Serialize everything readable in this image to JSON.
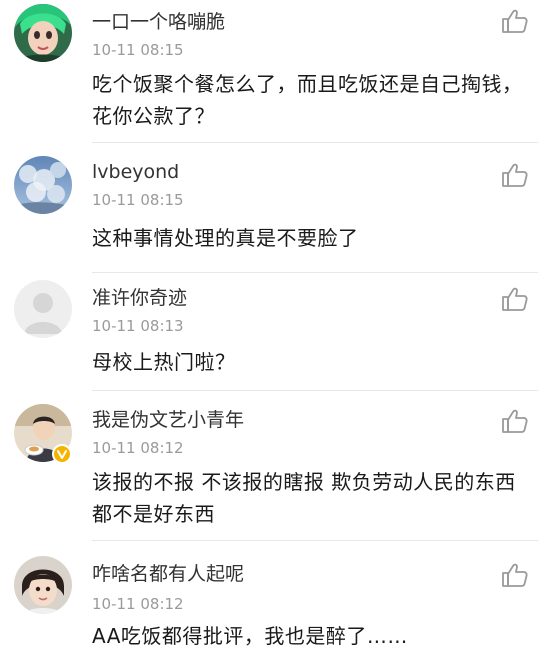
{
  "comments": [
    {
      "username": "一口一个咯嘣脆",
      "time": "10-11 08:15",
      "text": "吃个饭聚个餐怎么了，而且吃饭还是自己掏钱，花你公款了？",
      "avatar_icon": "green-hair-avatar-icon",
      "like_icon": "thumbs-up-icon"
    },
    {
      "username": "lvbeyond",
      "time": "10-11 08:15",
      "text": "这种事情处理的真是不要脸了",
      "avatar_icon": "sky-photo-avatar-icon",
      "like_icon": "thumbs-up-icon"
    },
    {
      "username": "准许你奇迹",
      "time": "10-11 08:13",
      "text": "母校上热门啦？",
      "avatar_icon": "default-user-avatar-icon",
      "like_icon": "thumbs-up-icon"
    },
    {
      "username": "我是伪文艺小青年",
      "time": "10-11 08:12",
      "text": "该报的不报 不该报的瞎报 欺负劳动人民的东西都不是好东西",
      "avatar_icon": "person-photo-avatar-icon",
      "like_icon": "thumbs-up-icon"
    },
    {
      "username": "咋啥名都有人起呢",
      "time": "10-11 08:12",
      "text": "AA吃饭都得批评，我也是醉了……",
      "avatar_icon": "child-photo-avatar-icon",
      "like_icon": "thumbs-up-icon"
    }
  ],
  "colors": {
    "username": "#333333",
    "timestamp": "#9a9a9a",
    "content": "#1a1a1a",
    "divider": "#e8e8e8",
    "like_icon": "#9a9a9a",
    "vip_badge": "#f5b400"
  }
}
